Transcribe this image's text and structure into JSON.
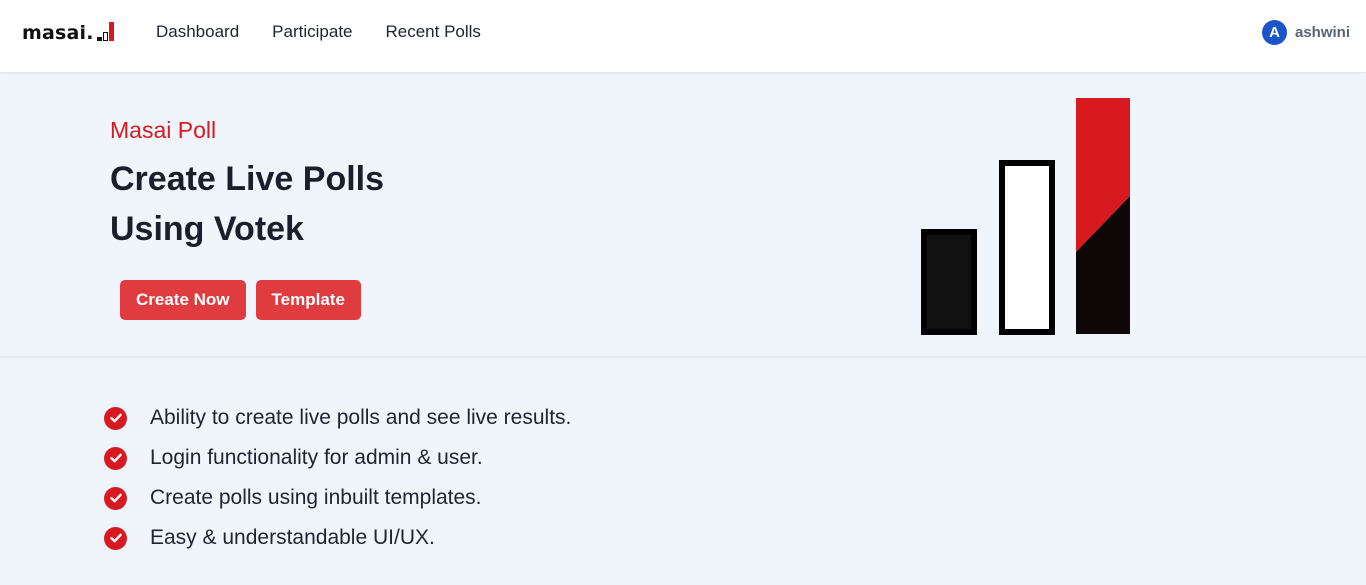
{
  "navbar": {
    "logo_text": "masai.",
    "links": [
      "Dashboard",
      "Participate",
      "Recent Polls"
    ],
    "user": {
      "avatar_letter": "A",
      "name": "ashwini"
    }
  },
  "hero": {
    "subtitle": "Masai Poll",
    "title_line1": "Create Live Polls",
    "title_line2": "Using Votek",
    "buttons": [
      "Create Now",
      "Template"
    ]
  },
  "features": [
    "Ability to create live polls and see live results.",
    "Login functionality for admin & user.",
    "Create polls using inbuilt templates.",
    "Easy & understandable UI/UX."
  ],
  "colors": {
    "brand_red": "#d71a20",
    "button_red": "#e03c3f",
    "avatar_blue": "#1a56c8",
    "hero_bg": "#f0f4fb"
  },
  "icons": [
    "check-circle-icon",
    "bar-chart-logo-icon"
  ]
}
